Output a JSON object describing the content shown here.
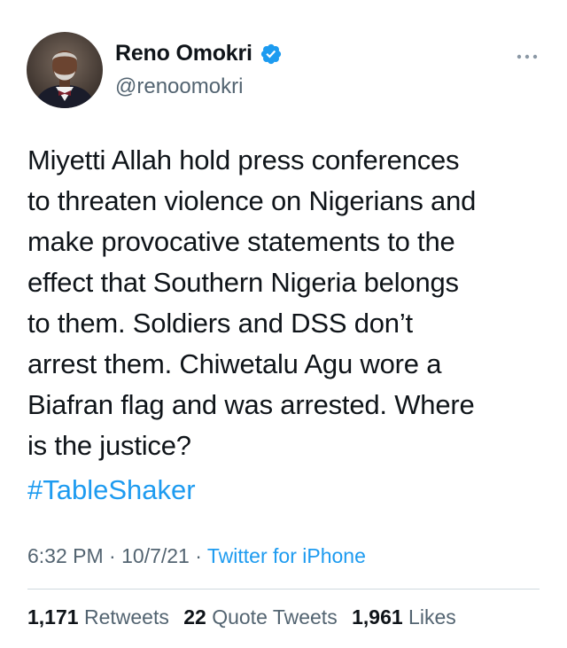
{
  "author": {
    "display_name": "Reno Omokri",
    "handle": "@renoomokri",
    "verified": true,
    "verified_icon": "verified-badge-icon",
    "avatar_icon": "profile-photo"
  },
  "tweet": {
    "text_lines": [
      "Miyetti Allah hold press conferences",
      "to threaten violence on Nigerians and",
      "make provocative statements to the",
      "effect that Southern Nigeria belongs",
      "to them. Soldiers and DSS don’t",
      "arrest them. Chiwetalu Agu wore a",
      "Biafran flag and was arrested. Where",
      "is the justice?"
    ],
    "hashtag": "#TableShaker"
  },
  "meta": {
    "time": "6:32 PM",
    "separator": " · ",
    "date": "10/7/21",
    "source": "Twitter for iPhone"
  },
  "stats": {
    "retweets_count": "1,171",
    "retweets_label": "Retweets",
    "quotes_count": "22",
    "quotes_label": "Quote Tweets",
    "likes_count": "1,961",
    "likes_label": "Likes"
  },
  "colors": {
    "accent": "#1d9bf0",
    "text_primary": "#0f1419",
    "text_secondary": "#536471",
    "divider": "#cfd9de"
  }
}
